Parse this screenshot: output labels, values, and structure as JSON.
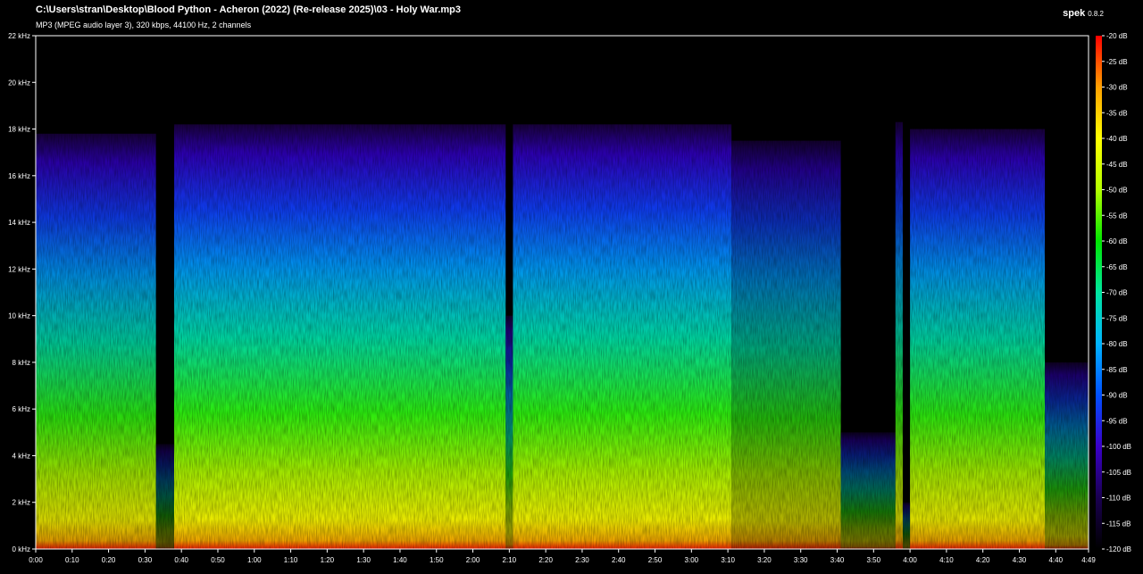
{
  "header": {
    "file_path": "C:\\Users\\stran\\Desktop\\Blood Python - Acheron (2022) (Re-release 2025)\\03 - Holy War.mp3",
    "file_info": "MP3 (MPEG audio layer 3), 320 kbps, 44100 Hz, 2 channels",
    "app_name": "spek",
    "app_version": "0.8.2"
  },
  "colors": {
    "background": "#000000",
    "text": "#ffffff",
    "palette": [
      "#000000",
      "#1a0050",
      "#3a00c8",
      "#0050ff",
      "#00b4ff",
      "#00e6c0",
      "#00e600",
      "#b4ff00",
      "#ffff00",
      "#ffa000",
      "#ff3c00",
      "#ff0000"
    ]
  },
  "chart_data": {
    "type": "heatmap",
    "title": "",
    "xlabel": "",
    "ylabel": "",
    "x_ticks": [
      "0:00",
      "0:10",
      "0:20",
      "0:30",
      "0:40",
      "0:50",
      "1:00",
      "1:10",
      "1:20",
      "1:30",
      "1:40",
      "1:50",
      "2:00",
      "2:10",
      "2:20",
      "2:30",
      "2:40",
      "2:50",
      "3:00",
      "3:10",
      "3:20",
      "3:30",
      "3:40",
      "3:50",
      "4:00",
      "4:10",
      "4:20",
      "4:30",
      "4:40",
      "4:49"
    ],
    "y_ticks": [
      "0 kHz",
      "2 kHz",
      "4 kHz",
      "6 kHz",
      "8 kHz",
      "10 kHz",
      "12 kHz",
      "14 kHz",
      "16 kHz",
      "18 kHz",
      "20 kHz",
      "22 kHz"
    ],
    "xlim_seconds": [
      0,
      289
    ],
    "ylim_khz": [
      0,
      22
    ],
    "colorbar": {
      "ticks": [
        "-20 dB",
        "-25 dB",
        "-30 dB",
        "-35 dB",
        "-40 dB",
        "-45 dB",
        "-50 dB",
        "-55 dB",
        "-60 dB",
        "-65 dB",
        "-70 dB",
        "-75 dB",
        "-80 dB",
        "-85 dB",
        "-90 dB",
        "-95 dB",
        "-100 dB",
        "-105 dB",
        "-110 dB",
        "-115 dB",
        "-120 dB"
      ],
      "range_db": [
        -120,
        -20
      ]
    },
    "segments": [
      {
        "start_s": 0,
        "end_s": 33,
        "cutoff_khz": 17.8,
        "intensity": 0.85
      },
      {
        "start_s": 33,
        "end_s": 38,
        "cutoff_khz": 4.5,
        "intensity": 0.35
      },
      {
        "start_s": 38,
        "end_s": 129,
        "cutoff_khz": 18.2,
        "intensity": 0.92
      },
      {
        "start_s": 129,
        "end_s": 131,
        "cutoff_khz": 10,
        "intensity": 0.6
      },
      {
        "start_s": 131,
        "end_s": 191,
        "cutoff_khz": 18.2,
        "intensity": 0.92
      },
      {
        "start_s": 191,
        "end_s": 221,
        "cutoff_khz": 17.5,
        "intensity": 0.7
      },
      {
        "start_s": 221,
        "end_s": 236,
        "cutoff_khz": 5,
        "intensity": 0.45
      },
      {
        "start_s": 236,
        "end_s": 238,
        "cutoff_khz": 18.3,
        "intensity": 0.75
      },
      {
        "start_s": 238,
        "end_s": 240,
        "cutoff_khz": 2,
        "intensity": 0.3
      },
      {
        "start_s": 240,
        "end_s": 277,
        "cutoff_khz": 18,
        "intensity": 0.88
      },
      {
        "start_s": 277,
        "end_s": 289,
        "cutoff_khz": 8,
        "intensity": 0.55
      }
    ]
  }
}
